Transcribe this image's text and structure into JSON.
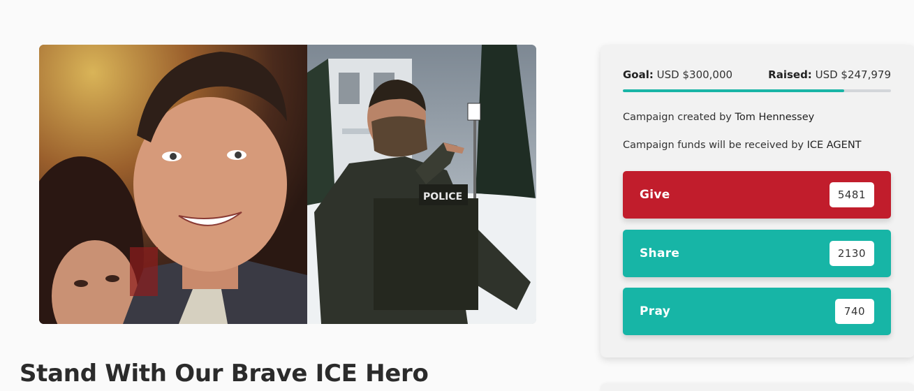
{
  "campaign": {
    "title": "Stand With Our Brave ICE Hero",
    "goal_label": "Goal:",
    "goal_value": "USD $300,000",
    "raised_label": "Raised:",
    "raised_value": "USD $247,979",
    "progress_fraction": 0.8266,
    "creator_prefix": "Campaign created by",
    "creator_name": "Tom Hennessey",
    "recipient_prefix": "Campaign funds will be received by",
    "recipient_name": "ICE AGENT"
  },
  "hero_image": {
    "left_photo": "selfie-photo",
    "right_photo": "agent-in-snow-photo"
  },
  "actions": [
    {
      "label": "Give",
      "count": "5481",
      "color": "#c11d2c"
    },
    {
      "label": "Share",
      "count": "2130",
      "color": "#17b5a6"
    },
    {
      "label": "Pray",
      "count": "740",
      "color": "#17b5a6"
    }
  ],
  "colors": {
    "accent": "#17b5a6",
    "give": "#c11d2c",
    "progress_track": "#d3d6da"
  }
}
